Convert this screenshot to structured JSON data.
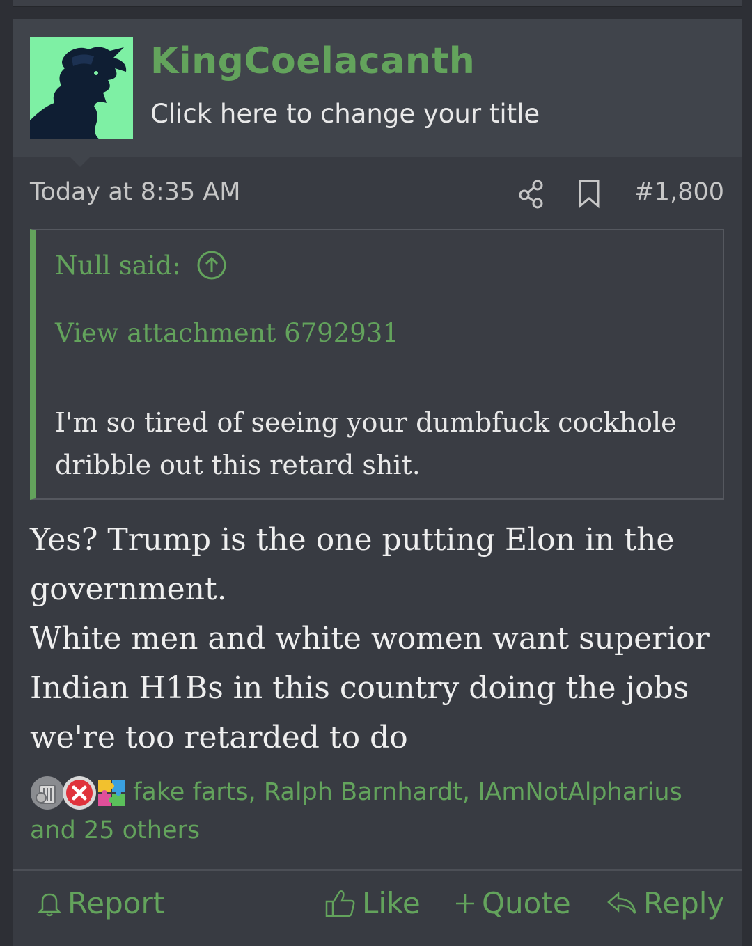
{
  "user": {
    "name": "KingCoelacanth",
    "title": "Click here to change your title"
  },
  "meta": {
    "date": "Today at 8:35 AM",
    "post_number": "#1,800"
  },
  "quote": {
    "attribution": "Null said:",
    "attachment": "View attachment 6792931",
    "text": "I'm so tired of seeing your dumbfuck cockhole dribble out this retard shit."
  },
  "body": {
    "lines": [
      "Yes? Trump is the one putting Elon in the government.",
      "White men and white women want superior Indian H1Bs in this country doing the jobs we're too retarded to do"
    ]
  },
  "reactions": {
    "names": "fake farts, Ralph Barnhardt, IAmNotAlpharius",
    "others": "and 25 others",
    "icons": [
      "trash-can-icon",
      "red-x-icon",
      "puzzle-piece-icon"
    ]
  },
  "actions": {
    "report": "Report",
    "like": "Like",
    "quote": "Quote",
    "reply": "Reply"
  },
  "colors": {
    "accent": "#63a35c",
    "background": "#383b42",
    "header": "#40444b"
  }
}
